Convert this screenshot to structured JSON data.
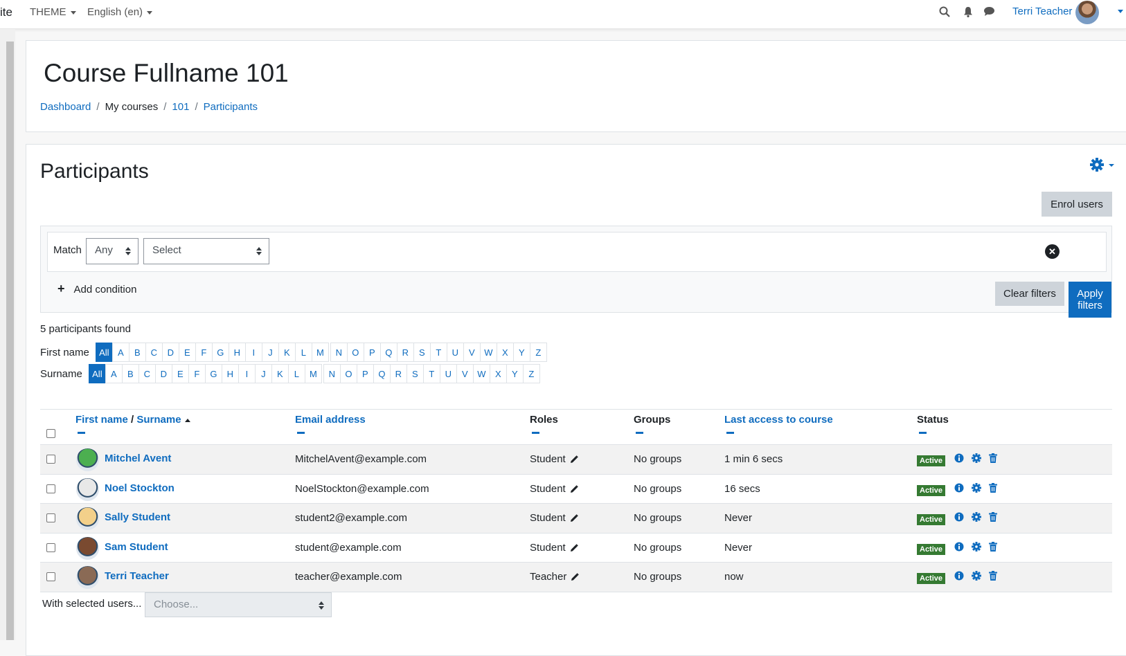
{
  "navbar": {
    "site_fragment": "ite",
    "theme_label": "THEME",
    "language_label": "English (en)",
    "user_name": "Terri Teacher"
  },
  "course": {
    "title": "Course Fullname 101",
    "breadcrumb": [
      "Dashboard",
      "My courses",
      "101",
      "Participants"
    ]
  },
  "participants": {
    "heading": "Participants",
    "enrol_button": "Enrol users",
    "filter": {
      "match_label": "Match",
      "match_value": "Any",
      "select_value": "Select",
      "add_condition": "Add condition",
      "clear_button": "Clear filters",
      "apply_button": "Apply filters"
    },
    "found_text": "5 participants found",
    "firstname_label": "First name",
    "surname_label": "Surname",
    "initials": [
      "All",
      "A",
      "B",
      "C",
      "D",
      "E",
      "F",
      "G",
      "H",
      "I",
      "J",
      "K",
      "L",
      "M",
      "N",
      "O",
      "P",
      "Q",
      "R",
      "S",
      "T",
      "U",
      "V",
      "W",
      "X",
      "Y",
      "Z"
    ],
    "columns": {
      "firstname": "First name",
      "slash": "/",
      "surname": "Surname",
      "email": "Email address",
      "roles": "Roles",
      "groups": "Groups",
      "lastaccess": "Last access to course",
      "status": "Status"
    },
    "rows": [
      {
        "name": "Mitchel Avent",
        "email": "MitchelAvent@example.com",
        "role": "Student",
        "groups": "No groups",
        "last_access": "1 min 6 secs",
        "status": "Active",
        "avatar_color": "#4caf50"
      },
      {
        "name": "Noel Stockton",
        "email": "NoelStockton@example.com",
        "role": "Student",
        "groups": "No groups",
        "last_access": "16 secs",
        "status": "Active",
        "avatar_color": "#e8e8e8"
      },
      {
        "name": "Sally Student",
        "email": "student2@example.com",
        "role": "Student",
        "groups": "No groups",
        "last_access": "Never",
        "status": "Active",
        "avatar_color": "#f3d08a"
      },
      {
        "name": "Sam Student",
        "email": "student@example.com",
        "role": "Student",
        "groups": "No groups",
        "last_access": "Never",
        "status": "Active",
        "avatar_color": "#7a4a30"
      },
      {
        "name": "Terri Teacher",
        "email": "teacher@example.com",
        "role": "Teacher",
        "groups": "No groups",
        "last_access": "now",
        "status": "Active",
        "avatar_color": "#8a6a55"
      }
    ],
    "bulk_label": "With selected users...",
    "bulk_placeholder": "Choose..."
  },
  "colors": {
    "link": "#0f6cbf",
    "badge_active": "#357a32",
    "row_stripe": "#f2f2f2"
  }
}
